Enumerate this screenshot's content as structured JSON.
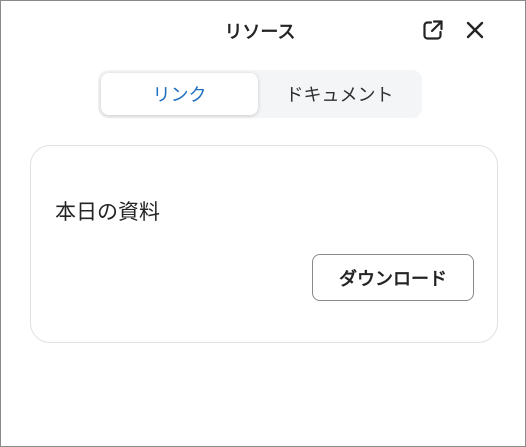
{
  "window": {
    "title": "リソース"
  },
  "header": {
    "popout_icon": "open-in-new-window-icon",
    "close_icon": "close-icon"
  },
  "tabs": [
    {
      "label": "リンク",
      "selected": true
    },
    {
      "label": "ドキュメント",
      "selected": false
    }
  ],
  "resource_card": {
    "title": "本日の資料",
    "download_label": "ダウンロード"
  },
  "colors": {
    "accent": "#1f6fbf",
    "text": "#242424",
    "tab_bar_bg": "#f4f5f7",
    "card_border": "#e1e1e1",
    "window_border": "#8a8a8a"
  }
}
